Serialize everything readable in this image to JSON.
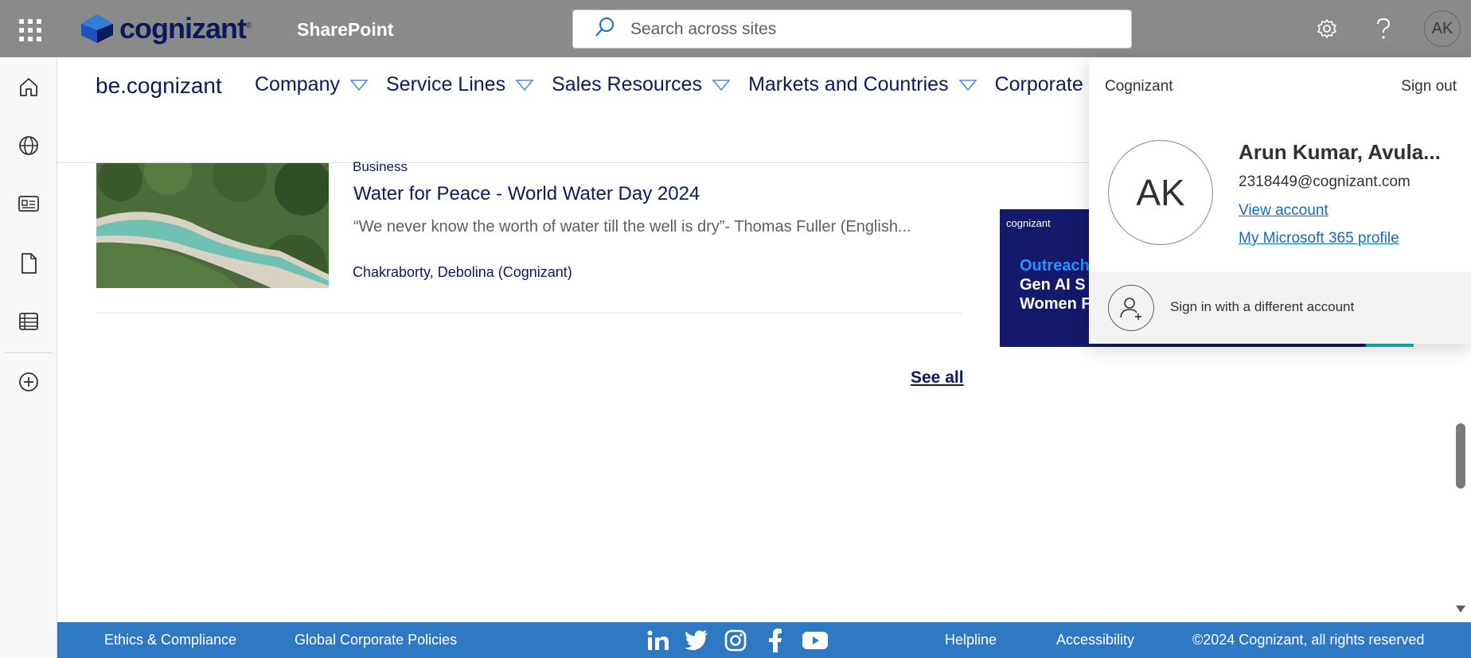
{
  "suite_bar": {
    "app_name": "SharePoint",
    "logo_text": "cognizant",
    "logo_mark": "®",
    "search_placeholder": "Search across sites",
    "avatar_initials": "AK"
  },
  "site": {
    "title": "be.cognizant",
    "nav": [
      {
        "label": "Company"
      },
      {
        "label": "Service Lines"
      },
      {
        "label": "Sales Resources"
      },
      {
        "label": "Markets and Countries"
      },
      {
        "label": "Corporate Func"
      }
    ]
  },
  "news": {
    "category": "Business",
    "title": "Water for Peace - World Water Day 2024",
    "description": "“We never know the worth of water till the well is dry”- Thomas Fuller (English...",
    "author": "Chakraborty, Debolina (Cognizant)",
    "see_all": "See all"
  },
  "promo": {
    "logo": "cognizant",
    "line1": "Outreach",
    "line2": "Gen AI S",
    "line3": "Women F"
  },
  "account_panel": {
    "org": "Cognizant",
    "sign_out": "Sign out",
    "initials": "AK",
    "name": "Arun Kumar, Avula...",
    "email": "2318449@cognizant.com",
    "view_account": "View account",
    "m365_profile": "My Microsoft 365 profile",
    "different_account": "Sign in with a different account"
  },
  "footer": {
    "ethics": "Ethics & Compliance",
    "policies": "Global Corporate Policies",
    "helpline": "Helpline",
    "accessibility": "Accessibility",
    "copyright": "©2024 Cognizant, all rights reserved",
    "social": [
      "linkedin-icon",
      "twitter-icon",
      "instagram-icon",
      "facebook-icon",
      "youtube-icon"
    ]
  },
  "colors": {
    "suite_bar": "#8a8a8a",
    "brand_navy": "#0b1a5c",
    "footer_blue": "#2f78c4",
    "link_blue": "#0f6cbd"
  }
}
